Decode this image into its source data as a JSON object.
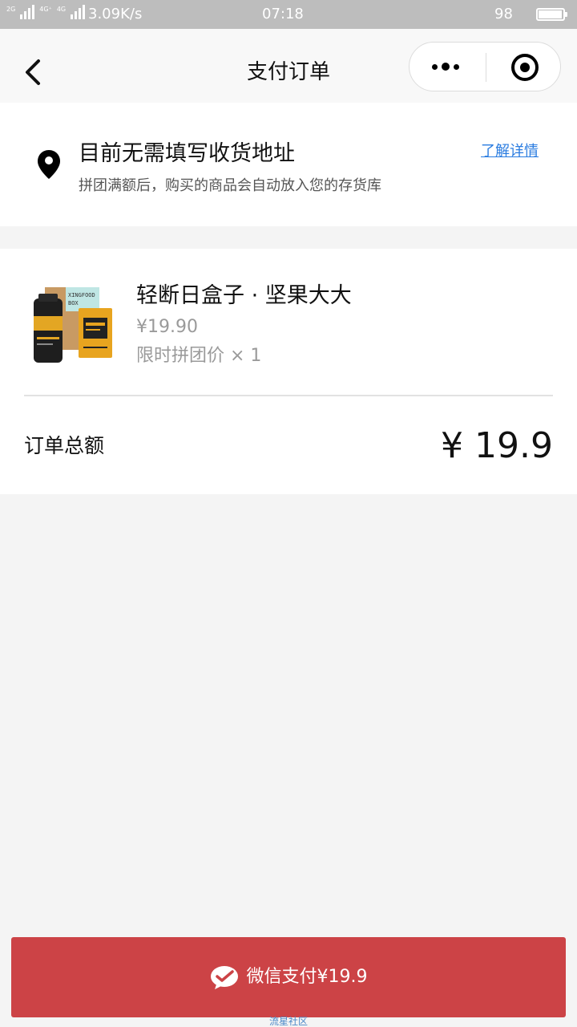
{
  "status_bar": {
    "sig1_tag": "2G",
    "sig2_tag": "4G⁺",
    "sig3_tag": "4G",
    "speed": "3.09K/s",
    "time": "07:18",
    "battery": "98",
    "battery_level": 0.98
  },
  "nav": {
    "title": "支付订单"
  },
  "address": {
    "title": "目前无需填写收货地址",
    "subtitle": "拼团满额后，购买的商品会自动放入您的存货库",
    "link": "了解详情"
  },
  "product": {
    "name": "轻断日盒子 · 坚果大大",
    "price": "¥19.90",
    "qty_text": "限时拼团价 × 1",
    "image_box_text": "XINGFOOD BOX"
  },
  "order": {
    "total_label": "订单总额",
    "total_value": "¥ 19.9"
  },
  "pay": {
    "label": "微信支付¥19.9"
  },
  "watermark": "流星社区",
  "colors": {
    "pay_button": "#cc4346",
    "link": "#2a7ce0"
  }
}
